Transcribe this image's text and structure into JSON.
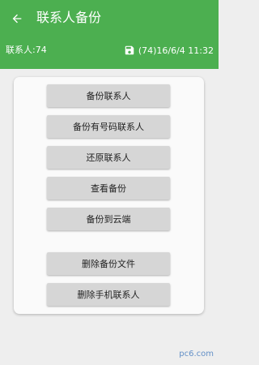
{
  "header": {
    "title": "联系人备份",
    "back_icon": "arrow-back-icon"
  },
  "status": {
    "contact_count": "联系人:74",
    "backup_icon": "floppy-disk-icon",
    "backup_info": "(74)16/6/4 11:32"
  },
  "actions": [
    {
      "label": "备份联系人"
    },
    {
      "label": "备份有号码联系人"
    },
    {
      "label": "还原联系人"
    },
    {
      "label": "查看备份"
    },
    {
      "label": "备份到云端"
    },
    {
      "label": "删除备份文件"
    },
    {
      "label": "删除手机联系人"
    }
  ],
  "watermark": "pc6.com",
  "colors": {
    "appbar": "#4caf50",
    "background": "#eeeeee",
    "button": "#d6d6d6"
  }
}
